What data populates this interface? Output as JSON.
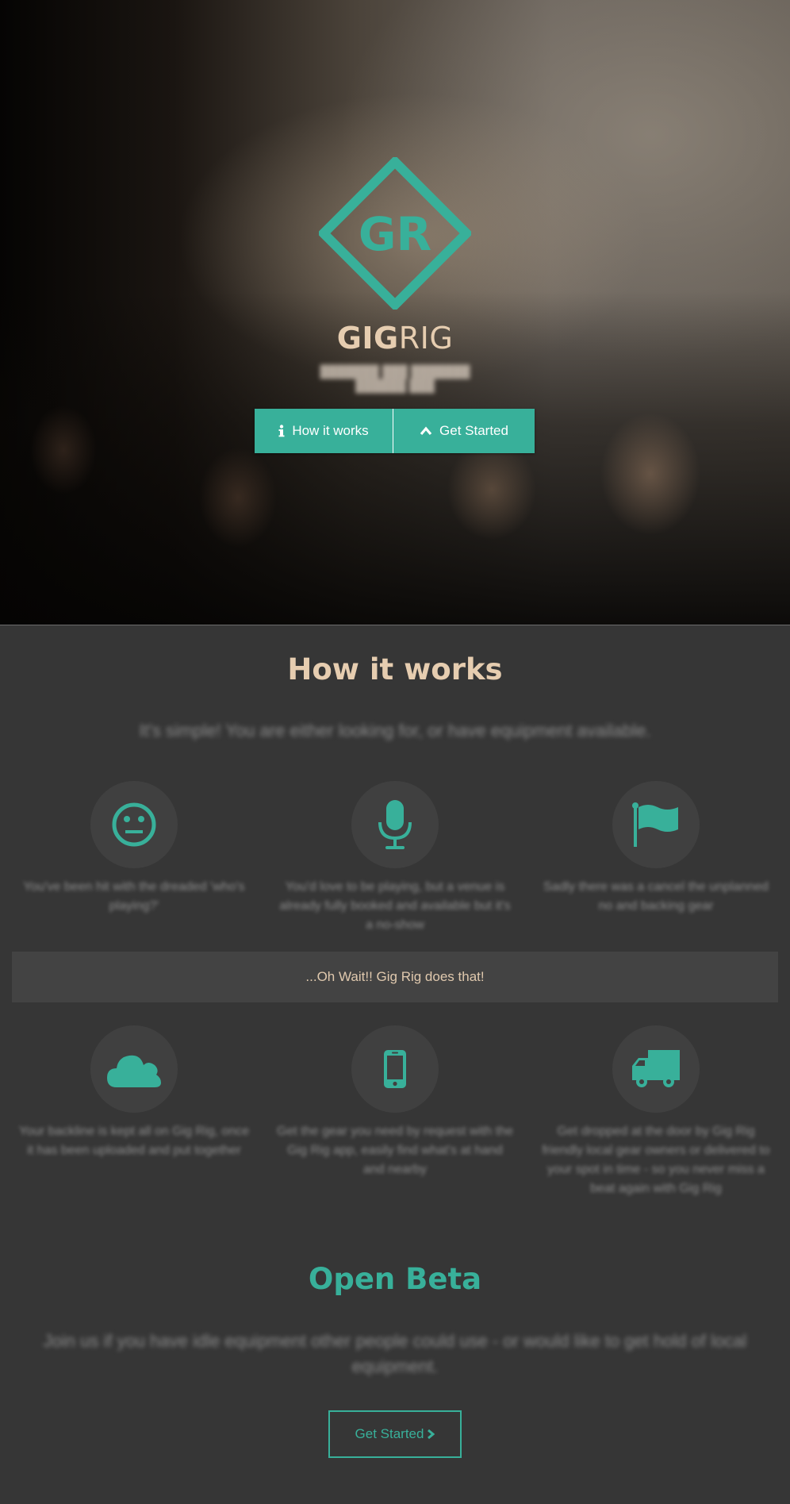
{
  "hero": {
    "logo_letters": "GR",
    "brand_bold": "GIG",
    "brand_light": "RIG",
    "tagline_line1": "███████ ███ ███████",
    "tagline_line2": "██████ ███",
    "buttons": {
      "how_it_works": "How it works",
      "get_started": "Get Started"
    }
  },
  "how": {
    "title": "How it works",
    "subtitle": "It's simple! You are either looking for, or have equipment available.",
    "features_top": [
      {
        "icon": "neutral-face-icon",
        "text": "You've been hit with the dreaded 'who's playing?'"
      },
      {
        "icon": "microphone-icon",
        "text": "You'd love to be playing, but a venue is already fully booked and available but it's a no-show"
      },
      {
        "icon": "flag-icon",
        "text": "Sadly there was a cancel the unplanned no and backing gear"
      }
    ],
    "banner": "...Oh Wait!! Gig Rig does that!",
    "features_bottom": [
      {
        "icon": "cloud-icon",
        "text": "Your backline is kept all on Gig Rig, once it has been uploaded and put together"
      },
      {
        "icon": "smartphone-icon",
        "text": "Get the gear you need by request with the Gig Rig app, easily find what's at hand and nearby"
      },
      {
        "icon": "truck-icon",
        "text": "Get dropped at the door by Gig Rig friendly local gear owners or delivered to your spot in time - so you never miss a beat again with Gig Rig"
      }
    ]
  },
  "beta": {
    "title": "Open Beta",
    "subtitle": "Join us if you have idle equipment other people could use - or would like to get hold of local equipment.",
    "button": "Get Started"
  },
  "colors": {
    "accent": "#38b09a",
    "heading_beige": "#e6cdb0",
    "section_bg": "#363636"
  }
}
